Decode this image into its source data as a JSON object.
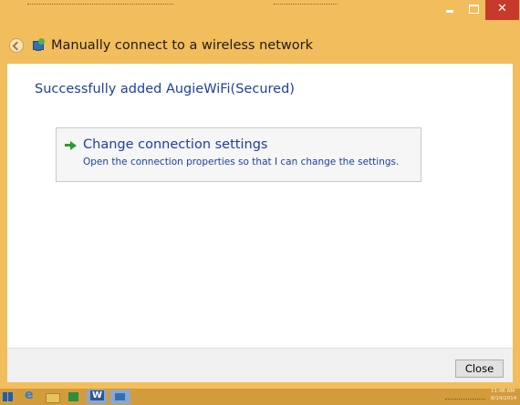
{
  "window": {
    "title": "Manually connect to a wireless network",
    "minimize_glyph": "",
    "maximize_glyph": "",
    "close_glyph": "✕"
  },
  "content": {
    "success_message": "Successfully added AugieWiFi(Secured)",
    "option": {
      "title": "Change connection settings",
      "description": "Open the connection properties so that I can change the settings.",
      "icon": "green-arrow-icon"
    }
  },
  "footer": {
    "close_label": "Close"
  },
  "taskbar": {
    "items": [
      "start-icon",
      "ie-icon",
      "file-explorer-icon",
      "store-icon",
      "word-icon",
      "network-icon"
    ],
    "clock_time": "11:46 AM",
    "clock_date": "8/14/2014"
  },
  "colors": {
    "chrome": "#f2bd5c",
    "close_button": "#c7392b",
    "link_text": "#1e3f9f",
    "taskbar": "#d29c3c"
  }
}
